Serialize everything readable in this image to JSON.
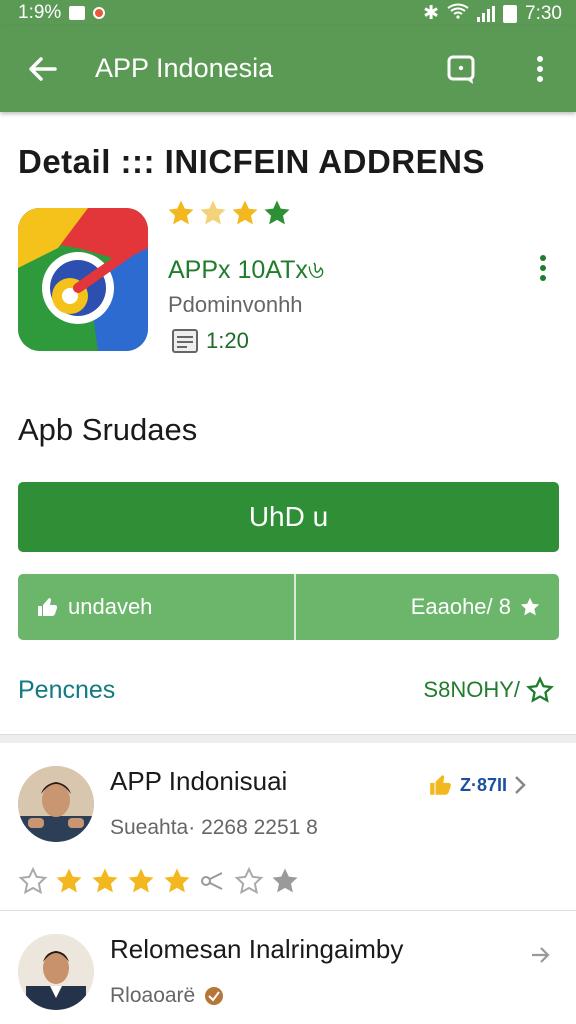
{
  "status_bar": {
    "left_text": "1:9%",
    "time": "7:30"
  },
  "app_bar": {
    "title": "APP Indonesia",
    "back_icon": "arrow-left-icon",
    "action_icon": "chat-square-icon",
    "more_icon": "more-vertical-icon"
  },
  "detail": {
    "title": "Detail ::: INICFEIN ADDRENS",
    "rating_stars": 4,
    "app_name": "APPx 10ATx৬",
    "developer": "Pdominvonhh",
    "size": "1:20"
  },
  "section": {
    "heading": "Apb Srudaes"
  },
  "buttons": {
    "primary": "UhD u",
    "split_left": "undaveh",
    "split_right": "Eaaohe/ 8"
  },
  "links": {
    "left": "Pencnes",
    "right": "S8NOHY/"
  },
  "reviews": [
    {
      "name": "APP Indonisuai",
      "meta": "Sueahta· 2268 2251 8",
      "badge": "Z·87II",
      "stars": 5
    },
    {
      "name": "Relomesan Inalringaimby",
      "meta": "Rloaoarë"
    }
  ],
  "colors": {
    "app_bar": "#5b9a55",
    "primary_button": "#2f8f37",
    "split_button": "#6cb66b",
    "star": "#f3b81f",
    "accent_green": "#1f7d2c",
    "link_teal": "#127a83"
  }
}
